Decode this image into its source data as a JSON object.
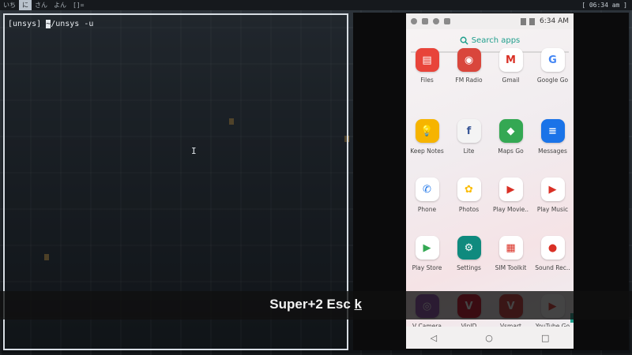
{
  "topbar": {
    "workspaces": [
      "いち",
      "に",
      "さん",
      "よん",
      "[]="
    ],
    "active_index": 1,
    "clock": "[ 06:34 am ]"
  },
  "terminal": {
    "prompt": "[unsys] ",
    "cursor_char": "~",
    "command": "/unsys -u"
  },
  "android": {
    "time": "6:34 AM",
    "search_label": "Search apps",
    "apps": [
      {
        "label": "Files",
        "icon": "files-icon",
        "color": "#e8443a",
        "glyph": "▤"
      },
      {
        "label": "FM Radio",
        "icon": "radio-icon",
        "color": "#d9463c",
        "glyph": "◉"
      },
      {
        "label": "Gmail",
        "icon": "gmail-icon",
        "color": "#ffffff",
        "glyph": "M"
      },
      {
        "label": "Google Go",
        "icon": "google-icon",
        "color": "#ffffff",
        "glyph": "G"
      },
      {
        "label": "Keep Notes",
        "icon": "bulb-icon",
        "color": "#f6b400",
        "glyph": "💡"
      },
      {
        "label": "Lite",
        "icon": "facebook-icon",
        "color": "#f4f4f4",
        "glyph": "f"
      },
      {
        "label": "Maps Go",
        "icon": "maps-icon",
        "color": "#34a853",
        "glyph": "◆"
      },
      {
        "label": "Messages",
        "icon": "messages-icon",
        "color": "#1a73e8",
        "glyph": "≡"
      },
      {
        "label": "Phone",
        "icon": "phone-icon",
        "color": "#ffffff",
        "glyph": "✆"
      },
      {
        "label": "Photos",
        "icon": "photos-icon",
        "color": "#ffffff",
        "glyph": "✿"
      },
      {
        "label": "Play Movie..",
        "icon": "movies-icon",
        "color": "#ffffff",
        "glyph": "▶"
      },
      {
        "label": "Play Music",
        "icon": "music-icon",
        "color": "#ffffff",
        "glyph": "▶"
      },
      {
        "label": "Play Store",
        "icon": "playstore-icon",
        "color": "#ffffff",
        "glyph": "▶"
      },
      {
        "label": "Settings",
        "icon": "gear-icon",
        "color": "#0f8a7e",
        "glyph": "⚙"
      },
      {
        "label": "SIM Toolkit",
        "icon": "simtoolkit-icon",
        "color": "#ffffff",
        "glyph": "▦"
      },
      {
        "label": "Sound Rec..",
        "icon": "mic-icon",
        "color": "#ffffff",
        "glyph": "●"
      },
      {
        "label": "V Camera",
        "icon": "camera-icon",
        "color": "#8e44ad",
        "glyph": "◎"
      },
      {
        "label": "VinID",
        "icon": "vinid-icon",
        "color": "#d0021b",
        "glyph": "V"
      },
      {
        "label": "Vsmart",
        "icon": "vsmart-icon",
        "color": "#d32f2f",
        "glyph": "V"
      },
      {
        "label": "YouTube Go",
        "icon": "youtube-icon",
        "color": "#ffffff",
        "glyph": "▶"
      }
    ]
  },
  "caption": {
    "prefix": "Super+2 Esc ",
    "key": "k"
  }
}
